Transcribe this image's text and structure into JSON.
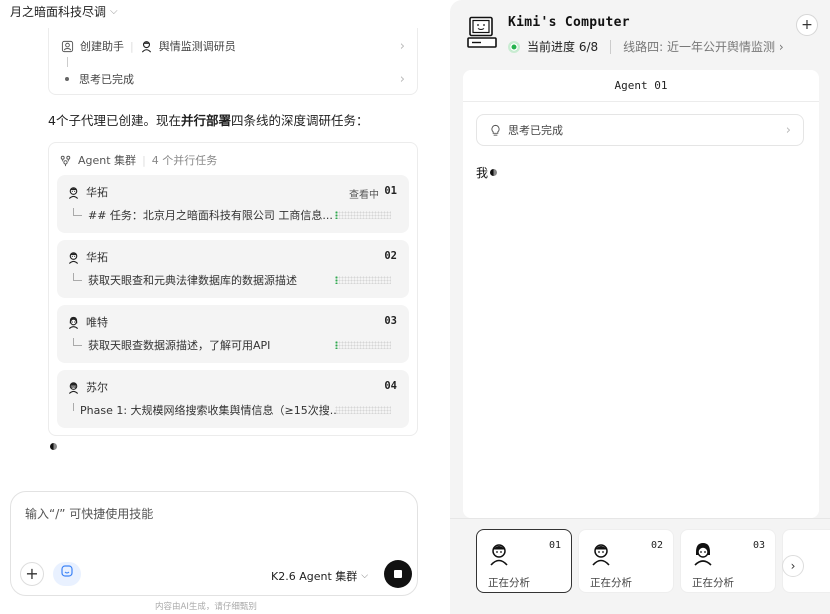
{
  "chat": {
    "title": "月之暗面科技尽调",
    "thinking_card": {
      "row1_label": "创建助手",
      "row1_agent": "舆情监测调研员",
      "row2_label": "思考已完成"
    },
    "summary_prefix": "4个子代理已创建。现在",
    "summary_bold": "并行部署",
    "summary_suffix": "四条线的深度调研任务：",
    "swarm": {
      "title": "Agent 集群",
      "count": "4 个并行任务",
      "tasks": [
        {
          "agent": "华拓",
          "num": "01",
          "viewing": "查看中",
          "desc": "## 任务：北京月之暗面科技有限公司 工商信息...",
          "progress": 0.05
        },
        {
          "agent": "华拓",
          "num": "02",
          "viewing": "",
          "desc": "获取天眼查和元典法律数据库的数据源描述",
          "progress": 0.05
        },
        {
          "agent": "唯特",
          "num": "03",
          "viewing": "",
          "desc": "获取天眼查数据源描述，了解可用API",
          "progress": 0.05
        },
        {
          "agent": "苏尔",
          "num": "04",
          "viewing": "",
          "desc": "Phase 1: 大规模网络搜索收集舆情信息（≥15次搜...",
          "progress": 0.0
        }
      ]
    }
  },
  "composer": {
    "placeholder": "输入“/” 可快捷使用技能",
    "model": "K2.6 Agent 集群",
    "footer": "内容由AI生成，请仔细甄别"
  },
  "computer": {
    "title": "Kimi's Computer",
    "progress_label": "当前进度 6/8",
    "route": "线路四: 近一年公开舆情监测",
    "screen_title": "Agent 01",
    "thinking": "思考已完成",
    "stream_text": "我",
    "agents": [
      {
        "num": "01",
        "status": "正在分析"
      },
      {
        "num": "02",
        "status": "正在分析"
      },
      {
        "num": "03",
        "status": "正在分析"
      }
    ]
  },
  "colors": {
    "accent_green": "#24b24c",
    "progress_green": "#2fa84f"
  },
  "icons": [
    "person-badge-icon",
    "avatar-icon",
    "dot-icon",
    "swarm-icon",
    "arrow-right-icon",
    "plus-icon",
    "skill-icon",
    "stop-icon",
    "computer-icon",
    "lightbulb-icon",
    "chevron-down-icon"
  ]
}
